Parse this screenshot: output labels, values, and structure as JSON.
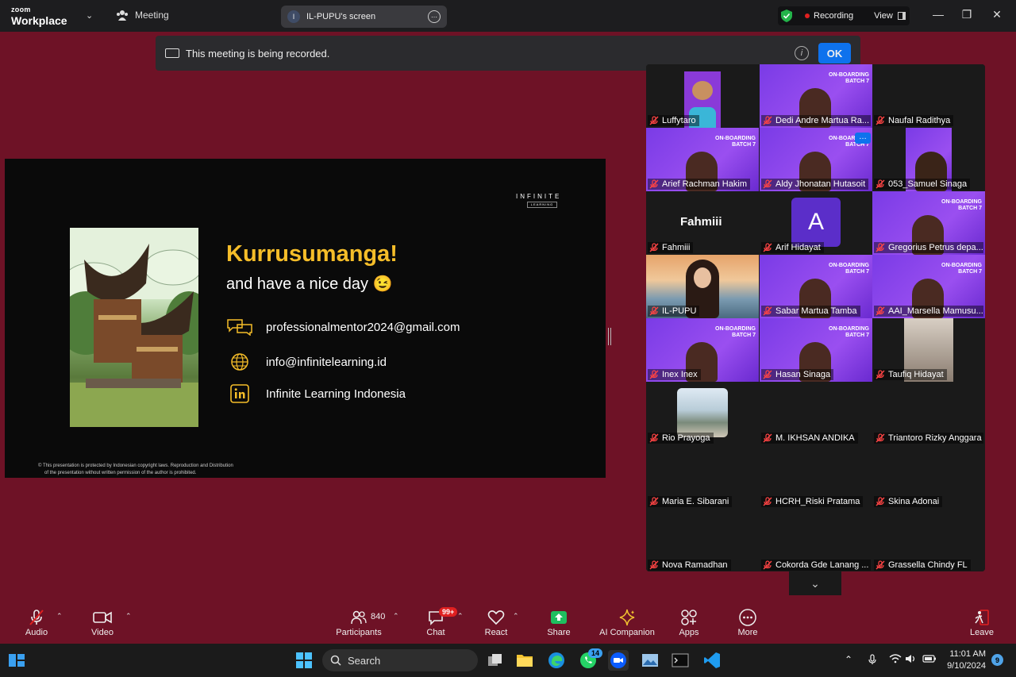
{
  "titlebar": {
    "brand_top": "zoom",
    "brand_bottom": "Workplace",
    "meeting_label": "Meeting",
    "screen_initial": "I",
    "screen_label": "IL-PUPU's screen",
    "recording_label": "Recording",
    "view_label": "View"
  },
  "banner": {
    "message": "This meeting is being recorded.",
    "ok_label": "OK"
  },
  "slide": {
    "logo": "INFINITE",
    "logo_sub": "LEARNING",
    "title": "Kurrusumanga!",
    "subtitle": "and have a nice day 😉",
    "contacts": [
      {
        "icon": "chat-bubbles-icon",
        "text": "professionalmentor2024@gmail.com"
      },
      {
        "icon": "globe-icon",
        "text": "info@infinitelearning.id"
      },
      {
        "icon": "linkedin-icon",
        "text": "Infinite Learning Indonesia"
      }
    ],
    "copyright_line1": "© This presentation is protected by Indonesian copyright laws. Reproduction and Distribution",
    "copyright_line2": "of the presentation without written permission of the author is prohibited."
  },
  "gallery": {
    "banner_text": "ON-BOARDING BATCH 7",
    "tile_avatar_letter": "A",
    "fahmi_display": "Fahmiii",
    "tiles": [
      {
        "name": "Luffytaro",
        "type": "avatar-cat"
      },
      {
        "name": "Dedi Andre Martua Ra...",
        "type": "banner"
      },
      {
        "name": "Naufal Radithya",
        "type": "dark"
      },
      {
        "name": "Arief Rachman Hakim",
        "type": "banner"
      },
      {
        "name": "Aldy Jhonatan Hutasoit",
        "type": "banner"
      },
      {
        "name": "053_Samuel Sinaga",
        "type": "banner-narrow"
      },
      {
        "name": "Fahmiii",
        "type": "text"
      },
      {
        "name": "Arif Hidayat",
        "type": "letter"
      },
      {
        "name": "Gregorius Petrus depa...",
        "type": "banner"
      },
      {
        "name": "IL-PUPU",
        "type": "active"
      },
      {
        "name": "Sabar Martua Tamba",
        "type": "banner"
      },
      {
        "name": "AAI_Marsella Mamusu...",
        "type": "banner"
      },
      {
        "name": "Inex Inex",
        "type": "banner"
      },
      {
        "name": "Hasan Sinaga",
        "type": "banner"
      },
      {
        "name": "Taufiq Hidayat",
        "type": "photo-narrow"
      },
      {
        "name": "Rio Prayoga",
        "type": "photo-small"
      },
      {
        "name": "M. IKHSAN ANDIKA",
        "type": "dark"
      },
      {
        "name": "Triantoro Rizky Anggara",
        "type": "dark"
      },
      {
        "name": "Maria E. Sibarani",
        "type": "dark"
      },
      {
        "name": "HCRH_Riski Pratama",
        "type": "dark"
      },
      {
        "name": "Skina Adonai",
        "type": "dark"
      },
      {
        "name": "Nova Ramadhan",
        "type": "dark"
      },
      {
        "name": "Cokorda Gde Lanang ...",
        "type": "dark"
      },
      {
        "name": "Grassella Chindy FL",
        "type": "dark"
      }
    ]
  },
  "toolbar": {
    "audio": "Audio",
    "video": "Video",
    "participants": "Participants",
    "participants_count": "840",
    "chat": "Chat",
    "chat_badge": "99+",
    "react": "React",
    "share": "Share",
    "ai_companion": "AI Companion",
    "apps": "Apps",
    "more": "More",
    "leave": "Leave"
  },
  "taskbar": {
    "search_label": "Search",
    "whatsapp_badge": "14",
    "time": "11:01 AM",
    "date": "9/10/2024",
    "notifications": "9"
  },
  "colors": {
    "meeting_bg": "#6e1226",
    "slide_title": "#f5bd29",
    "ok_button": "#0e72ed",
    "share_green": "#1fbf5f",
    "ai_gold": "#f0c030",
    "active_speaker": "#2bd19a"
  }
}
